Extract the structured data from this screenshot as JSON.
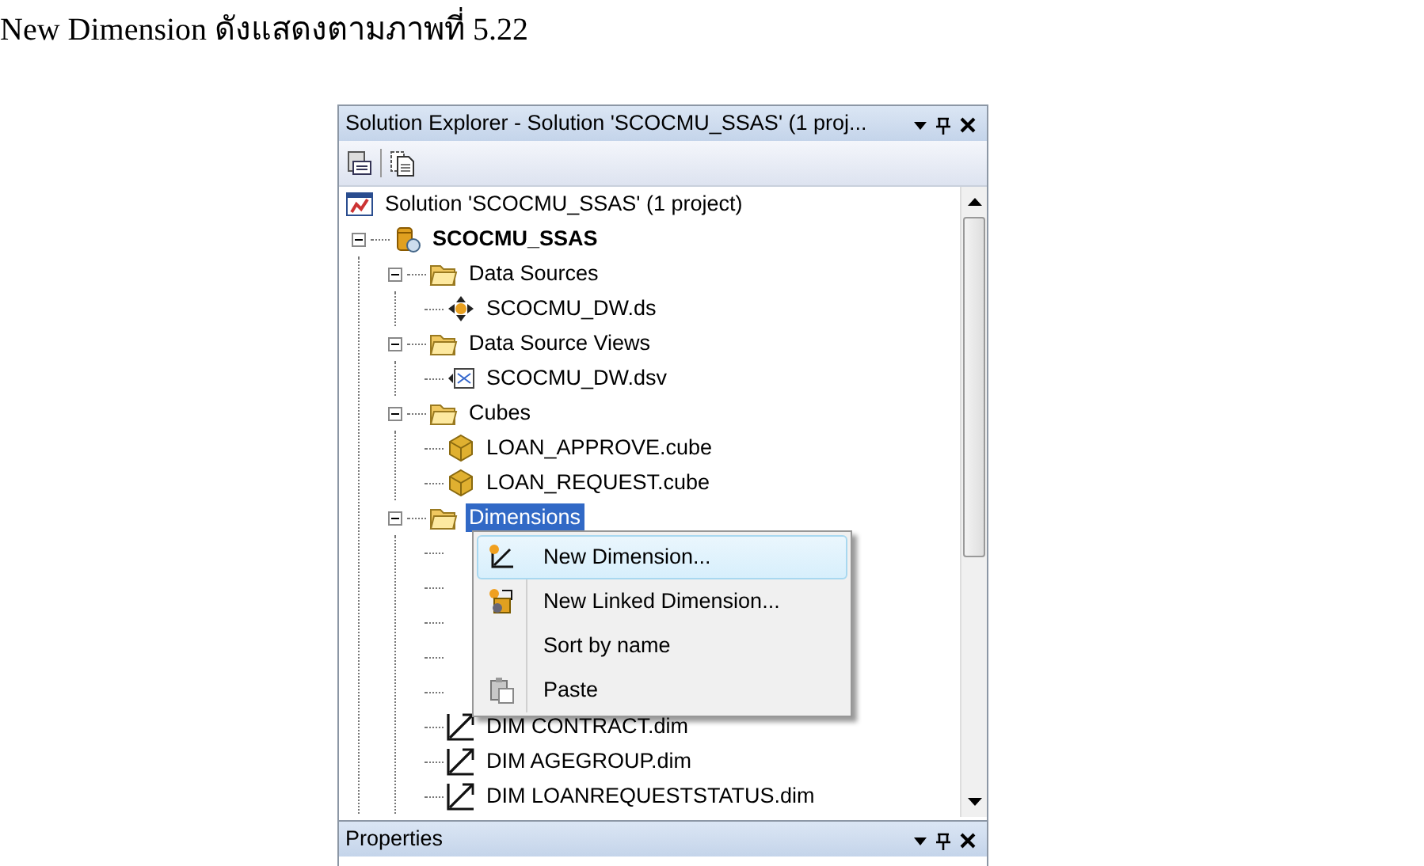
{
  "caption": "New Dimension ดังแสดงตามภาพที่  5.22",
  "panel": {
    "title": "Solution Explorer - Solution 'SCOCMU_SSAS' (1 proj..."
  },
  "tree": [
    {
      "label": "Solution 'SCOCMU_SSAS' (1 project)",
      "kind": "solution",
      "selected": false,
      "children": [
        {
          "label": "SCOCMU_SSAS",
          "kind": "project",
          "expanded": true,
          "selected": false,
          "children": [
            {
              "label": "Data Sources",
              "kind": "folder",
              "expanded": true,
              "selected": false,
              "children": [
                {
                  "label": "SCOCMU_DW.ds",
                  "kind": "datasource",
                  "selected": false
                }
              ]
            },
            {
              "label": "Data Source Views",
              "kind": "folder",
              "expanded": true,
              "selected": false,
              "children": [
                {
                  "label": "SCOCMU_DW.dsv",
                  "kind": "dsv",
                  "selected": false
                }
              ]
            },
            {
              "label": "Cubes",
              "kind": "folder",
              "expanded": true,
              "selected": false,
              "children": [
                {
                  "label": "LOAN_APPROVE.cube",
                  "kind": "cube",
                  "selected": false
                },
                {
                  "label": "LOAN_REQUEST.cube",
                  "kind": "cube",
                  "selected": false
                }
              ]
            },
            {
              "label": "Dimensions",
              "kind": "folder",
              "expanded": true,
              "selected": true,
              "children": [
                {
                  "label": "DIM CONTRACT.dim",
                  "kind": "dimension",
                  "selected": false
                },
                {
                  "label": "DIM AGEGROUP.dim",
                  "kind": "dimension",
                  "selected": false
                },
                {
                  "label": "DIM LOANREQUESTSTATUS.dim",
                  "kind": "dimension",
                  "selected": false
                }
              ]
            }
          ]
        }
      ]
    }
  ],
  "context_menu": [
    {
      "label": "New Dimension...",
      "selected": true
    },
    {
      "label": "New Linked Dimension...",
      "selected": false
    },
    {
      "label": "Sort by name",
      "selected": false
    },
    {
      "label": "Paste",
      "selected": false
    }
  ],
  "properties_panel": {
    "title": "Properties"
  }
}
